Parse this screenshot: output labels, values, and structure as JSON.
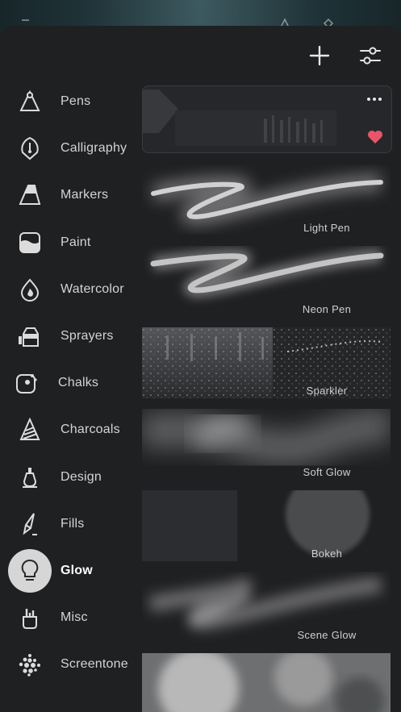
{
  "header": {
    "add_icon": "plus-icon",
    "settings_icon": "sliders-icon"
  },
  "categories": [
    {
      "label": "Pens",
      "icon": "pen-nib-icon",
      "active": false
    },
    {
      "label": "Calligraphy",
      "icon": "calligraphy-nib-icon",
      "active": false
    },
    {
      "label": "Markers",
      "icon": "marker-icon",
      "active": false
    },
    {
      "label": "Paint",
      "icon": "paint-pot-icon",
      "active": false
    },
    {
      "label": "Watercolor",
      "icon": "water-drop-icon",
      "active": false
    },
    {
      "label": "Sprayers",
      "icon": "spray-can-icon",
      "active": false
    },
    {
      "label": "Chalks",
      "icon": "chalk-icon",
      "active": false
    },
    {
      "label": "Charcoals",
      "icon": "charcoal-icon",
      "active": false
    },
    {
      "label": "Design",
      "icon": "design-pen-icon",
      "active": false
    },
    {
      "label": "Fills",
      "icon": "fill-brush-icon",
      "active": false
    },
    {
      "label": "Glow",
      "icon": "lightbulb-icon",
      "active": true
    },
    {
      "label": "Misc",
      "icon": "brush-cup-icon",
      "active": false
    },
    {
      "label": "Screentone",
      "icon": "halftone-dots-icon",
      "active": false
    }
  ],
  "brushes": [
    {
      "name": "",
      "favorite": true,
      "has_more_menu": true
    },
    {
      "name": "Light Pen"
    },
    {
      "name": "Neon Pen"
    },
    {
      "name": "Sparkler"
    },
    {
      "name": "Soft Glow"
    },
    {
      "name": "Bokeh"
    },
    {
      "name": "Scene Glow"
    },
    {
      "name": ""
    }
  ],
  "colors": {
    "panel": "#1f2022",
    "active_circle": "#d6d6d6",
    "favorite": "#e8556a"
  }
}
